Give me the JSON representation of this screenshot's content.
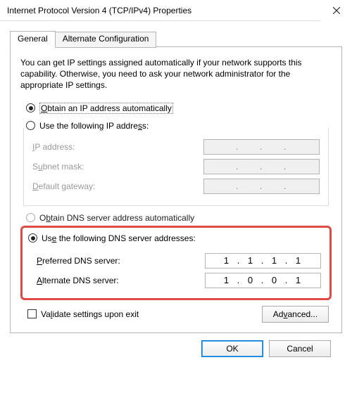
{
  "window": {
    "title": "Internet Protocol Version 4 (TCP/IPv4) Properties"
  },
  "tabs": {
    "general": "General",
    "alternate": "Alternate Configuration"
  },
  "description": "You can get IP settings assigned automatically if your network supports this capability. Otherwise, you need to ask your network administrator for the appropriate IP settings.",
  "ip": {
    "auto_label_pre": "O",
    "auto_label_post": "btain an IP address automatically",
    "manual_label_pre": "Use the following IP addre",
    "manual_label_ul": "s",
    "manual_label_post": "s:",
    "ip_label_ul": "I",
    "ip_label_post": "P address:",
    "subnet_label_pre": "S",
    "subnet_label_ul": "u",
    "subnet_label_post": "bnet mask:",
    "gateway_label_ul": "D",
    "gateway_label_post": "efault gateway:",
    "ip_value": "",
    "subnet_value": "",
    "gateway_value": ""
  },
  "dns": {
    "auto_label_pre": "O",
    "auto_label_ul": "b",
    "auto_label_post": "tain DNS server address automatically",
    "manual_label_pre": "Us",
    "manual_label_ul": "e",
    "manual_label_post": " the following DNS server addresses:",
    "preferred_label_ul": "P",
    "preferred_label_post": "referred DNS server:",
    "alternate_label_ul": "A",
    "alternate_label_post": "lternate DNS server:",
    "preferred": {
      "o1": "1",
      "o2": "1",
      "o3": "1",
      "o4": "1"
    },
    "alternate": {
      "o1": "1",
      "o2": "0",
      "o3": "0",
      "o4": "1"
    }
  },
  "validate_label_pre": "Va",
  "validate_label_ul": "l",
  "validate_label_post": "idate settings upon exit",
  "buttons": {
    "advanced": "Ad",
    "advanced_ul": "v",
    "advanced_post": "anced...",
    "ok": "OK",
    "cancel": "Cancel"
  }
}
